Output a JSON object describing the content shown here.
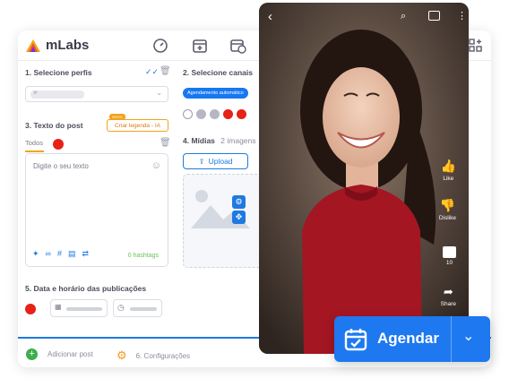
{
  "app": {
    "logo_text": "mLabs"
  },
  "sections": {
    "profiles": "1. Selecione perfis",
    "channels": "2. Selecione canais",
    "text": "3. Texto do post",
    "media": "4. Mídias",
    "media_count": "2 imagens",
    "datetime": "5. Data e horário das publicações"
  },
  "channels": {
    "auto_schedule_pill": "Agendamento automático"
  },
  "ai_button": {
    "badge": "NOVO",
    "label": "Criar legenda - IA"
  },
  "tabs": {
    "all": "Todos"
  },
  "editor": {
    "placeholder": "Digite o seu texto",
    "hashtags": "0 hashtags"
  },
  "media_actions": {
    "upload": "Upload"
  },
  "footer": {
    "add_post": "Adicionar post",
    "settings": "6. Configurações"
  },
  "phone": {
    "like": "Like",
    "dislike": "Dislike",
    "comments": "10",
    "share": "Share"
  },
  "cta": {
    "label": "Agendar"
  },
  "colors": {
    "primary": "#1e78f0",
    "brand_orange": "#f3a21a",
    "youtube_red": "#e62117",
    "dress_red": "#a31622"
  }
}
